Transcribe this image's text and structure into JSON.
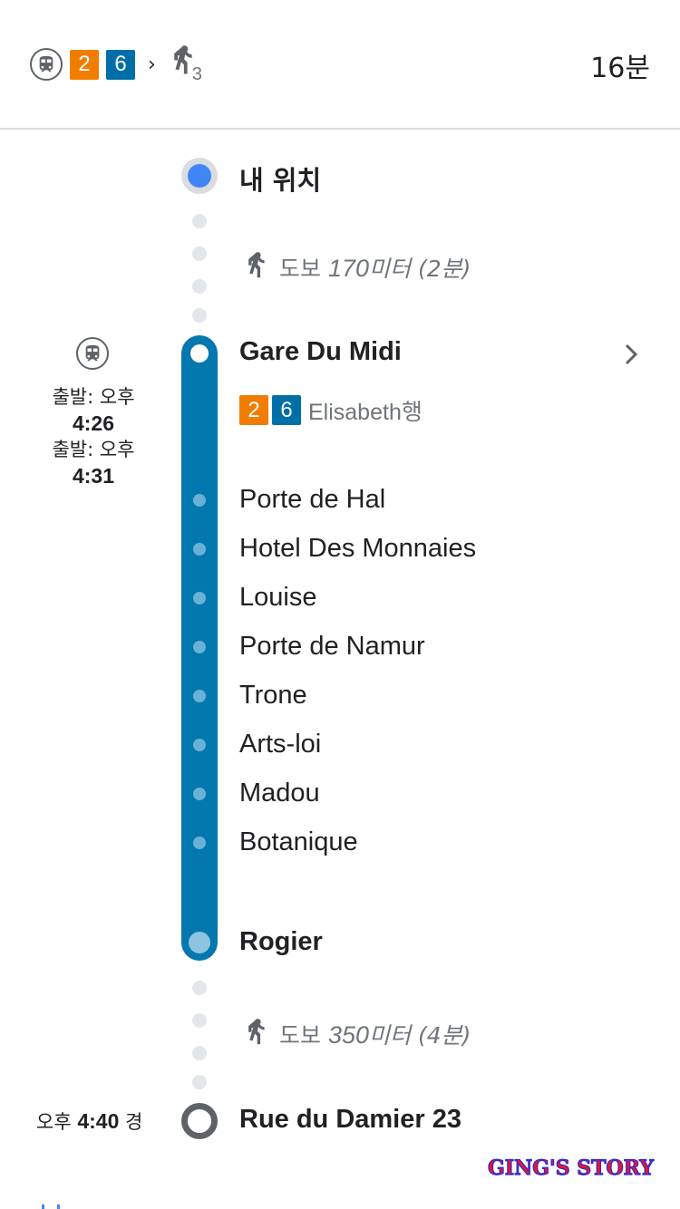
{
  "header": {
    "line_badges": [
      {
        "label": "2",
        "color": "#f07d00"
      },
      {
        "label": "6",
        "color": "#006fa8"
      }
    ],
    "separator": "›",
    "walk_subscript": "3",
    "duration": "16분"
  },
  "origin": {
    "label": "내 위치",
    "icon": "my-location-dot"
  },
  "walk1": {
    "prefix": "도보 ",
    "distance": "170",
    "unit": "미터 ",
    "time": "(2분)"
  },
  "transit": {
    "icon": "tram-icon",
    "departures": [
      {
        "label": "출발: 오후",
        "time": "4:26"
      },
      {
        "label": "출발: 오후",
        "time": "4:31"
      }
    ],
    "board_station": "Gare Du Midi",
    "lines": [
      {
        "label": "2",
        "color": "#f07d00"
      },
      {
        "label": "6",
        "color": "#006fa8"
      }
    ],
    "direction": "Elisabeth행",
    "intermediate_stops": [
      "Porte de Hal",
      "Hotel Des Monnaies",
      "Louise",
      "Porte de Namur",
      "Trone",
      "Arts-loi",
      "Madou",
      "Botanique"
    ],
    "alight_station": "Rogier",
    "line_color": "#0278ae"
  },
  "walk2": {
    "prefix": "도보 ",
    "distance": "350",
    "unit": "미터 ",
    "time": "(4분)"
  },
  "destination": {
    "arrival_prefix": "오후 ",
    "arrival_time": "4:40",
    "arrival_suffix": " 경",
    "name": "Rue du Damier 23"
  },
  "watermark": "GING'S STORY"
}
